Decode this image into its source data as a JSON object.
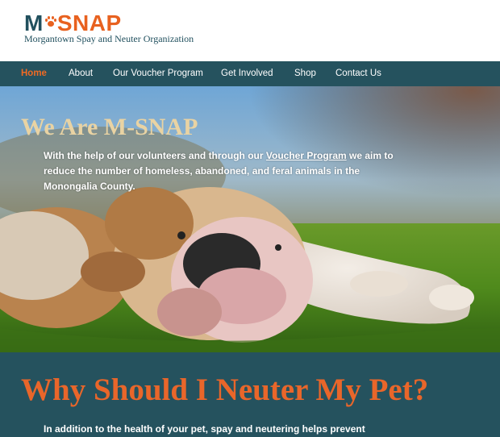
{
  "header": {
    "logo_m": "M",
    "logo_snap": "SNAP",
    "tagline": "Morgantown Spay and Neuter Organization"
  },
  "nav": {
    "items": [
      {
        "label": "Home",
        "active": true
      },
      {
        "label": "About"
      },
      {
        "label": "Our Voucher Program"
      },
      {
        "label": "Get Involved"
      },
      {
        "label": "Shop"
      },
      {
        "label": "Contact Us"
      }
    ]
  },
  "hero": {
    "title": "We Are M-SNAP",
    "text_before_link": "With the help of our volunteers and through our ",
    "link_label": "Voucher Program",
    "text_after_link": " we aim to reduce the number of homeless, abandoned, and feral animals in the Monongalia County."
  },
  "why": {
    "title": "Why Should I Neuter My Pet?",
    "text": "In addition to the health of your pet, spay and neutering helps prevent"
  },
  "colors": {
    "brand_teal": "#25525e",
    "brand_orange": "#e8611f",
    "hero_title": "#e9d3a3"
  }
}
